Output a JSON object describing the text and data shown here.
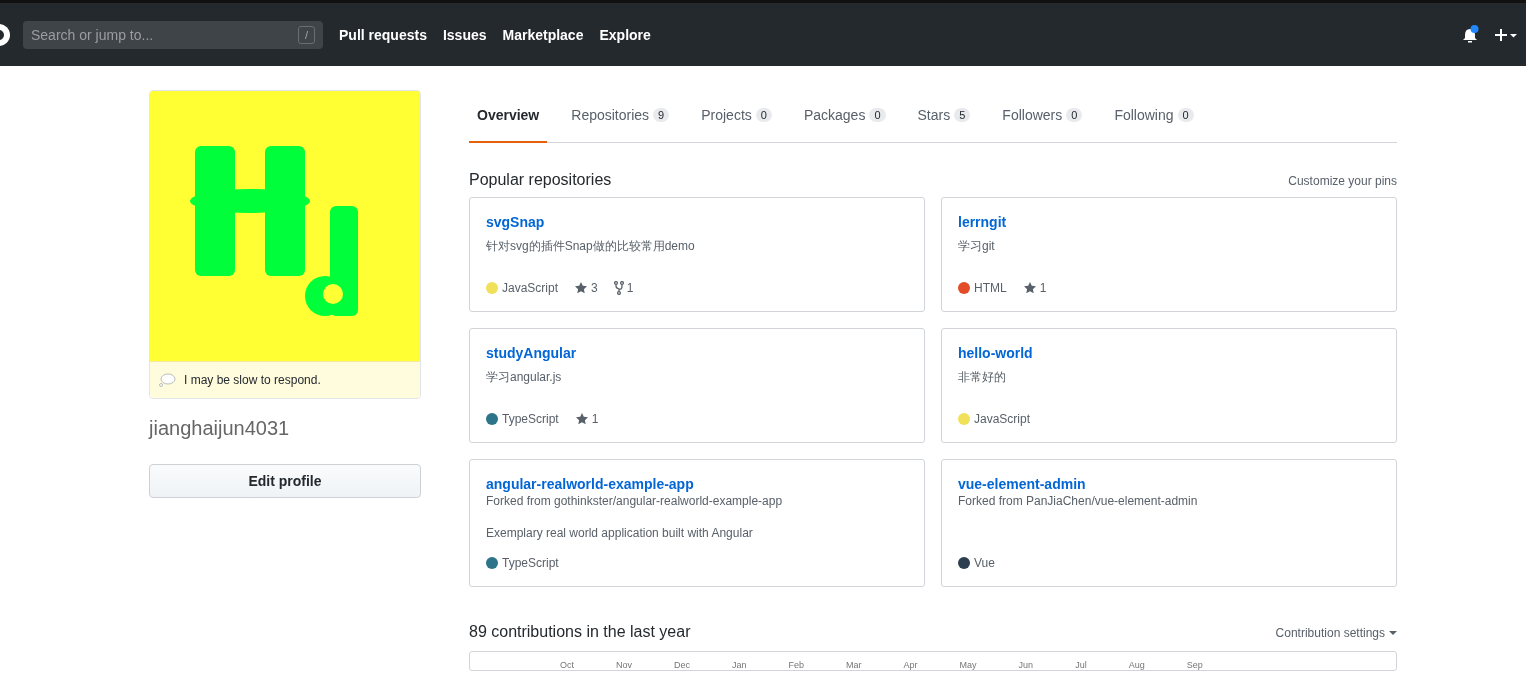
{
  "header": {
    "search": {
      "placeholder": "Search or jump to...",
      "key": "/"
    },
    "nav": [
      "Pull requests",
      "Issues",
      "Marketplace",
      "Explore"
    ]
  },
  "profile": {
    "status": "I may be slow to respond.",
    "username": "jianghaijun4031",
    "edit_button": "Edit profile"
  },
  "tabs": [
    {
      "label": "Overview",
      "selected": true
    },
    {
      "label": "Repositories",
      "count": "9",
      "selected": false
    },
    {
      "label": "Projects",
      "count": "0",
      "selected": false
    },
    {
      "label": "Packages",
      "count": "0",
      "selected": false
    },
    {
      "label": "Stars",
      "count": "5",
      "selected": false
    },
    {
      "label": "Followers",
      "count": "0",
      "selected": false
    },
    {
      "label": "Following",
      "count": "0",
      "selected": false
    }
  ],
  "popular": {
    "title": "Popular repositories",
    "customize": "Customize your pins",
    "repos": [
      {
        "name": "svgSnap",
        "description": "针对svg的插件Snap做的比较常用demo",
        "language": "JavaScript",
        "color": "#f1e05a",
        "stars": "3",
        "forks": "1"
      },
      {
        "name": "lerrngit",
        "description": "学习git",
        "language": "HTML",
        "color": "#e34c26",
        "stars": "1"
      },
      {
        "name": "studyAngular",
        "description": "学习angular.js",
        "language": "TypeScript",
        "color": "#2b7489",
        "stars": "1"
      },
      {
        "name": "hello-world",
        "description": "非常好的",
        "language": "JavaScript",
        "color": "#f1e05a"
      },
      {
        "name": "angular-realworld-example-app",
        "forked_from": "Forked from gothinkster/angular-realworld-example-app",
        "description": "Exemplary real world application built with Angular",
        "language": "TypeScript",
        "color": "#2b7489"
      },
      {
        "name": "vue-element-admin",
        "forked_from": "Forked from PanJiaChen/vue-element-admin",
        "language": "Vue",
        "color": "#2c3e50"
      }
    ]
  },
  "contributions": {
    "title": "89 contributions in the last year",
    "settings": "Contribution settings",
    "months": [
      "Oct",
      "Nov",
      "Dec",
      "Jan",
      "Feb",
      "Mar",
      "Apr",
      "May",
      "Jun",
      "Jul",
      "Aug",
      "Sep"
    ]
  }
}
